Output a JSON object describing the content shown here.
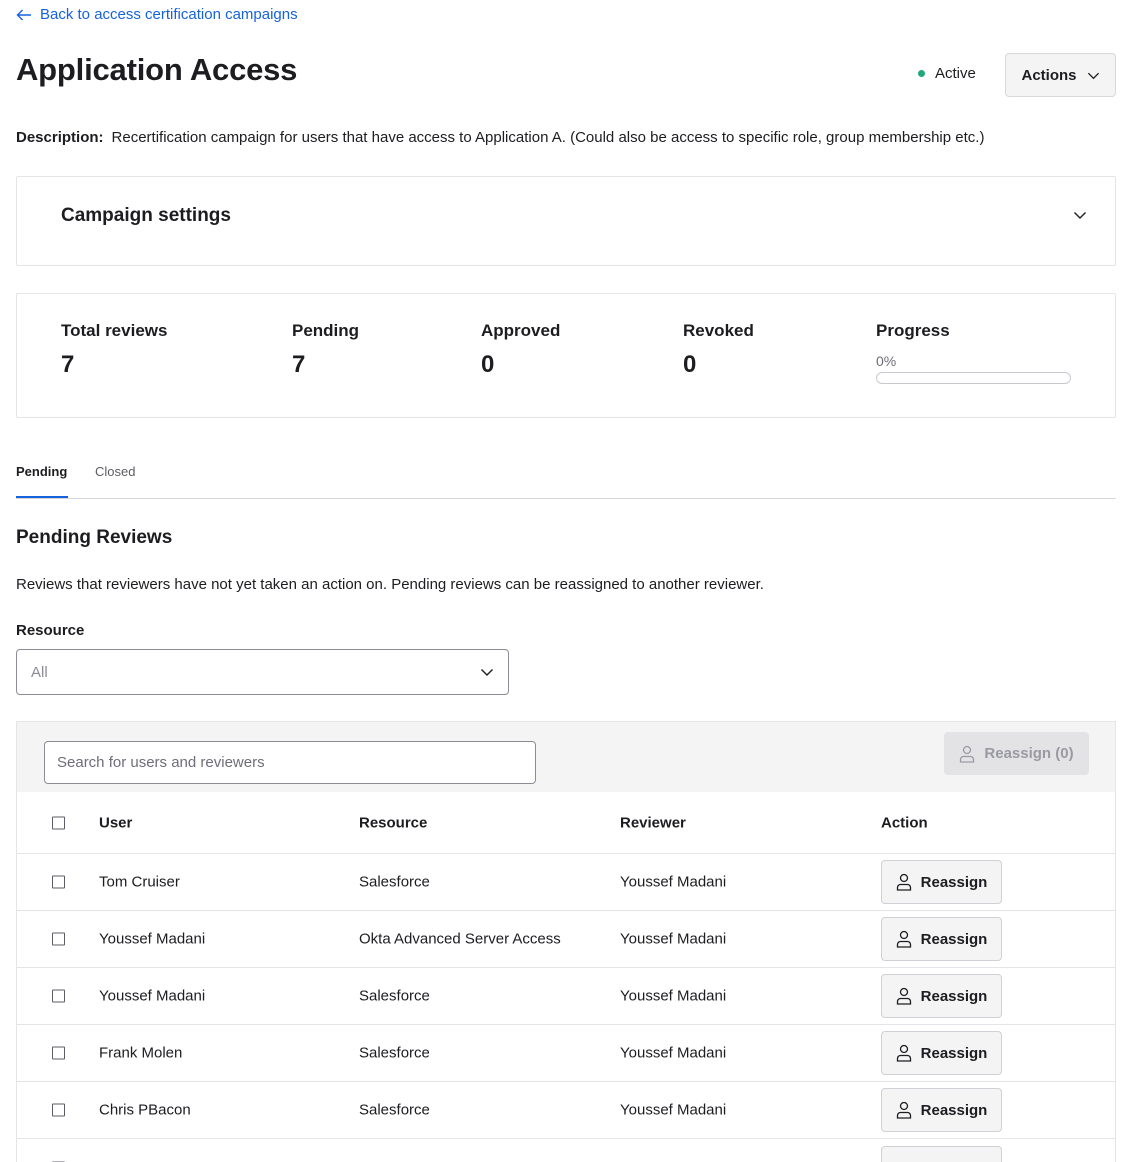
{
  "back_link": {
    "label": "Back to access certification campaigns"
  },
  "page_title": "Application Access",
  "status": {
    "label": "Active",
    "color": "#1fa97a"
  },
  "actions_button": {
    "label": "Actions"
  },
  "description": {
    "label": "Description:",
    "text": "Recertification campaign for users that have access to Application A. (Could also be access to specific role, group membership etc.)"
  },
  "campaign_settings": {
    "title": "Campaign settings"
  },
  "stats": {
    "total_reviews": {
      "label": "Total reviews",
      "value": "7"
    },
    "pending": {
      "label": "Pending",
      "value": "7"
    },
    "approved": {
      "label": "Approved",
      "value": "0"
    },
    "revoked": {
      "label": "Revoked",
      "value": "0"
    },
    "progress": {
      "label": "Progress",
      "value_text": "0%",
      "fraction": 0
    }
  },
  "tabs": [
    {
      "label": "Pending",
      "active": true
    },
    {
      "label": "Closed",
      "active": false
    }
  ],
  "pending_reviews": {
    "title": "Pending Reviews",
    "description": "Reviews that reviewers have not yet taken an action on. Pending reviews can be reassigned to another reviewer."
  },
  "resource_filter": {
    "label": "Resource",
    "value": "All"
  },
  "search": {
    "placeholder": "Search for users and reviewers"
  },
  "bulk_reassign": {
    "label": "Reassign (0)"
  },
  "table": {
    "columns": {
      "user": "User",
      "resource": "Resource",
      "reviewer": "Reviewer",
      "action": "Action"
    },
    "action_label": "Reassign",
    "rows": [
      {
        "user": "Tom Cruiser",
        "resource": "Salesforce",
        "reviewer": "Youssef Madani"
      },
      {
        "user": "Youssef Madani",
        "resource": "Okta Advanced Server Access",
        "reviewer": "Youssef Madani"
      },
      {
        "user": "Youssef Madani",
        "resource": "Salesforce",
        "reviewer": "Youssef Madani"
      },
      {
        "user": "Frank Molen",
        "resource": "Salesforce",
        "reviewer": "Youssef Madani"
      },
      {
        "user": "Chris PBacon",
        "resource": "Salesforce",
        "reviewer": "Youssef Madani"
      }
    ]
  }
}
